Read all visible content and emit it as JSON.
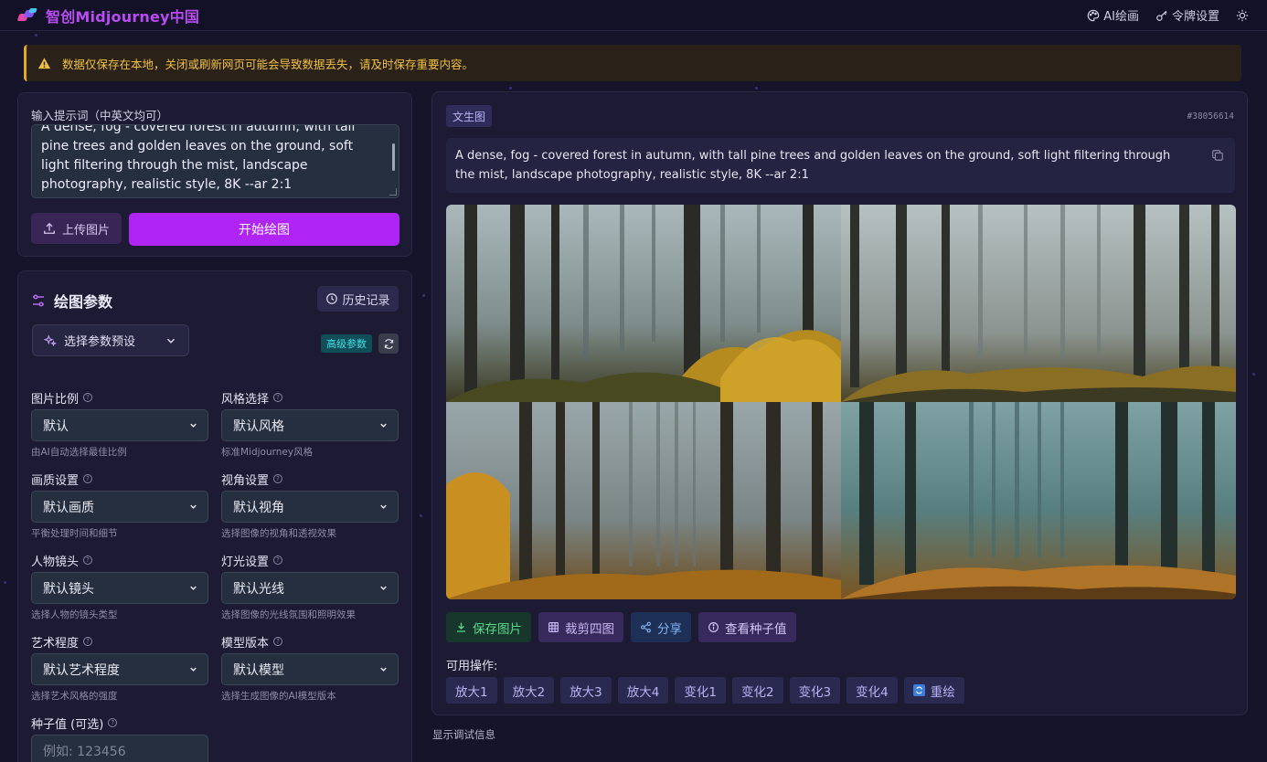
{
  "header": {
    "brand": "智创Midjourney中国",
    "nav": [
      {
        "label": "AI绘画",
        "icon": "palette-icon"
      },
      {
        "label": "令牌设置",
        "icon": "key-icon"
      }
    ],
    "theme_icon": "sun-icon"
  },
  "alert": {
    "icon": "warning-icon",
    "color": "#f0c040",
    "text": "数据仅保存在本地，关闭或刷新网页可能会导致数据丢失，请及时保存重要内容。"
  },
  "prompt": {
    "label": "输入提示词（中英文均可）",
    "value": "A dense, fog - covered forest in autumn, with tall pine trees and golden leaves on the ground, soft light filtering through the mist, landscape photography, realistic style, 8K --ar 2:1",
    "upload_label": "上传图片",
    "start_label": "开始绘图",
    "accent": "#b024f5"
  },
  "params": {
    "title": "绘图参数",
    "history_label": "历史记录",
    "preset_label": "选择参数预设",
    "advanced_label": "高级参数",
    "fields": [
      {
        "label": "图片比例",
        "value": "默认",
        "hint": "由AI自动选择最佳比例"
      },
      {
        "label": "风格选择",
        "value": "默认风格",
        "hint": "标准Midjourney风格"
      },
      {
        "label": "画质设置",
        "value": "默认画质",
        "hint": "平衡处理时间和细节"
      },
      {
        "label": "视角设置",
        "value": "默认视角",
        "hint": "选择图像的视角和透视效果"
      },
      {
        "label": "人物镜头",
        "value": "默认镜头",
        "hint": "选择人物的镜头类型"
      },
      {
        "label": "灯光设置",
        "value": "默认光线",
        "hint": "选择图像的光线氛围和照明效果"
      },
      {
        "label": "艺术程度",
        "value": "默认艺术程度",
        "hint": "选择艺术风格的强度"
      },
      {
        "label": "模型版本",
        "value": "默认模型",
        "hint": "选择生成图像的AI模型版本"
      }
    ],
    "seed": {
      "label": "种子值 (可选)",
      "placeholder": "例如: 123456"
    }
  },
  "result": {
    "mode": "文生图",
    "job_id": "#38056614",
    "prompt": "A dense, fog - covered forest in autumn, with tall pine trees and golden leaves on the ground, soft light filtering through the mist, landscape photography, realistic style, 8K --ar 2:1",
    "actions": [
      {
        "label": "保存图片",
        "icon": "download-icon"
      },
      {
        "label": "裁剪四图",
        "icon": "grid-icon"
      },
      {
        "label": "分享",
        "icon": "share-icon"
      },
      {
        "label": "查看种子值",
        "icon": "info-icon"
      }
    ],
    "ops_label": "可用操作:",
    "ops": [
      "放大1",
      "放大2",
      "放大3",
      "放大4",
      "变化1",
      "变化2",
      "变化3",
      "变化4"
    ],
    "reroll_label": "重绘"
  },
  "debug_label": "显示调试信息"
}
